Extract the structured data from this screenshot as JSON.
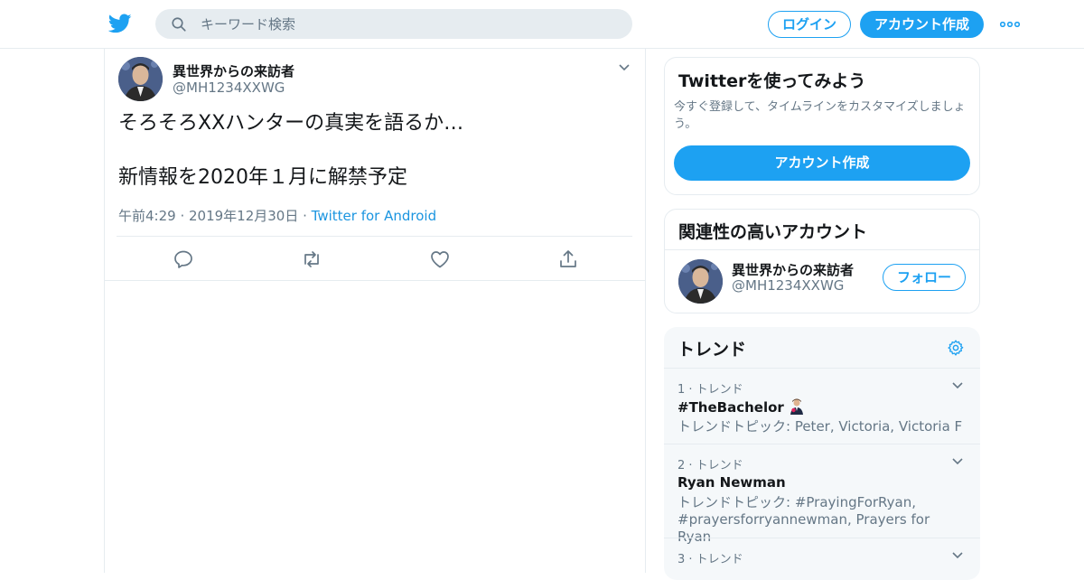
{
  "header": {
    "search_placeholder": "キーワード検索",
    "login_label": "ログイン",
    "signup_label": "アカウント作成",
    "brand_color": "#1da1f2"
  },
  "tweet": {
    "author_name": "異世界からの来訪者",
    "author_handle": "@MH1234XXWG",
    "text": "そろそろXXハンターの真実を語るか…\n\n新情報を2020年１月に解禁予定",
    "time": "午前4:29 · 2019年12月30日",
    "dot": " · ",
    "source": "Twitter for Android"
  },
  "sidebar": {
    "try_card": {
      "title": "Twitterを使ってみよう",
      "description": "今すぐ登録して、タイムラインをカスタマイズしましょう。",
      "button": "アカウント作成"
    },
    "related": {
      "title": "関連性の高いアカウント",
      "name": "異世界からの来訪者",
      "handle": "@MH1234XXWG",
      "follow": "フォロー"
    },
    "trends": {
      "title": "トレンド",
      "items": [
        {
          "rank": "1 · トレンド",
          "name": "#TheBachelor",
          "topic": "トレンドトピック: Peter, Victoria, Victoria F"
        },
        {
          "rank": "2 · トレンド",
          "name": "Ryan Newman",
          "topic": "トレンドトピック: #PrayingForRyan, #prayersforryannewman, Prayers for Ryan"
        },
        {
          "rank": "3 · トレンド",
          "name": "",
          "topic": ""
        }
      ]
    }
  }
}
